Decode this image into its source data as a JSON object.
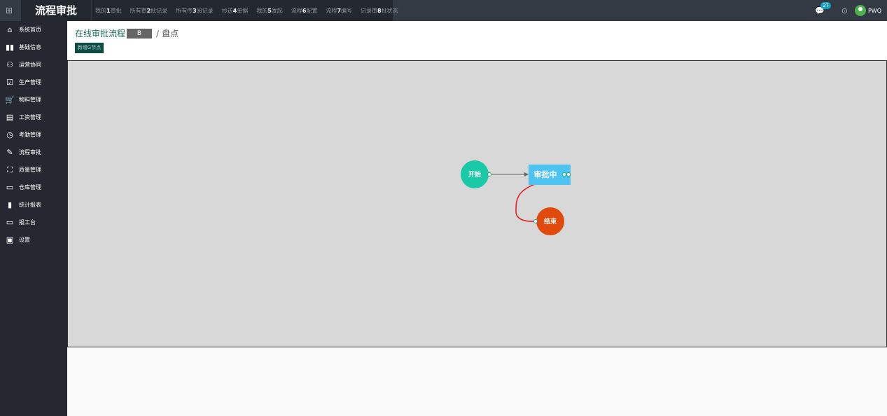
{
  "app": {
    "title": "流程审批"
  },
  "topnav": [
    {
      "pre": "我的",
      "num": "1",
      "post": "审批"
    },
    {
      "pre": "所有审",
      "num": "2",
      "post": "批记录"
    },
    {
      "pre": "所有传",
      "num": "3",
      "post": "阅记录"
    },
    {
      "pre": "抄送",
      "num": "4",
      "post": "单据"
    },
    {
      "pre": "我的",
      "num": "5",
      "post": "发起"
    },
    {
      "pre": "流程",
      "num": "6",
      "post": "配置"
    },
    {
      "pre": "流程",
      "num": "7",
      "post": "编号"
    },
    {
      "pre": "记录审",
      "num": "8",
      "post": "批状态"
    }
  ],
  "header": {
    "message_count": "27",
    "user_name": "PWQ"
  },
  "sidebar": [
    {
      "label": "系统首页",
      "icon": "home-icon"
    },
    {
      "label": "基础信息",
      "icon": "book-icon"
    },
    {
      "label": "运营协同",
      "icon": "team-icon"
    },
    {
      "label": "生产管理",
      "icon": "checkbox-icon"
    },
    {
      "label": "物料管理",
      "icon": "cart-icon"
    },
    {
      "label": "工资管理",
      "icon": "calculator-icon"
    },
    {
      "label": "考勤管理",
      "icon": "clock-icon"
    },
    {
      "label": "流程审批",
      "icon": "approval-icon"
    },
    {
      "label": "质量管理",
      "icon": "quality-icon"
    },
    {
      "label": "仓库管理",
      "icon": "warehouse-icon"
    },
    {
      "label": "统计报表",
      "icon": "bar-chart-icon"
    },
    {
      "label": "报工台",
      "icon": "monitor-icon"
    },
    {
      "label": "设置",
      "icon": "briefcase-icon"
    }
  ],
  "breadcrumb": {
    "link": "在线审批流程",
    "mask": "B",
    "separator": "/",
    "current": "盘点"
  },
  "toolbar": {
    "new_node_label": "新增G节点"
  },
  "flow": {
    "start": {
      "label": "开始",
      "color": "#19c9a8"
    },
    "middle": {
      "label": "审批中",
      "color": "#4cc3f0"
    },
    "end": {
      "label": "结束",
      "color": "#e04a0c"
    },
    "line_color": "#666666",
    "return_line_color": "#e02020"
  }
}
